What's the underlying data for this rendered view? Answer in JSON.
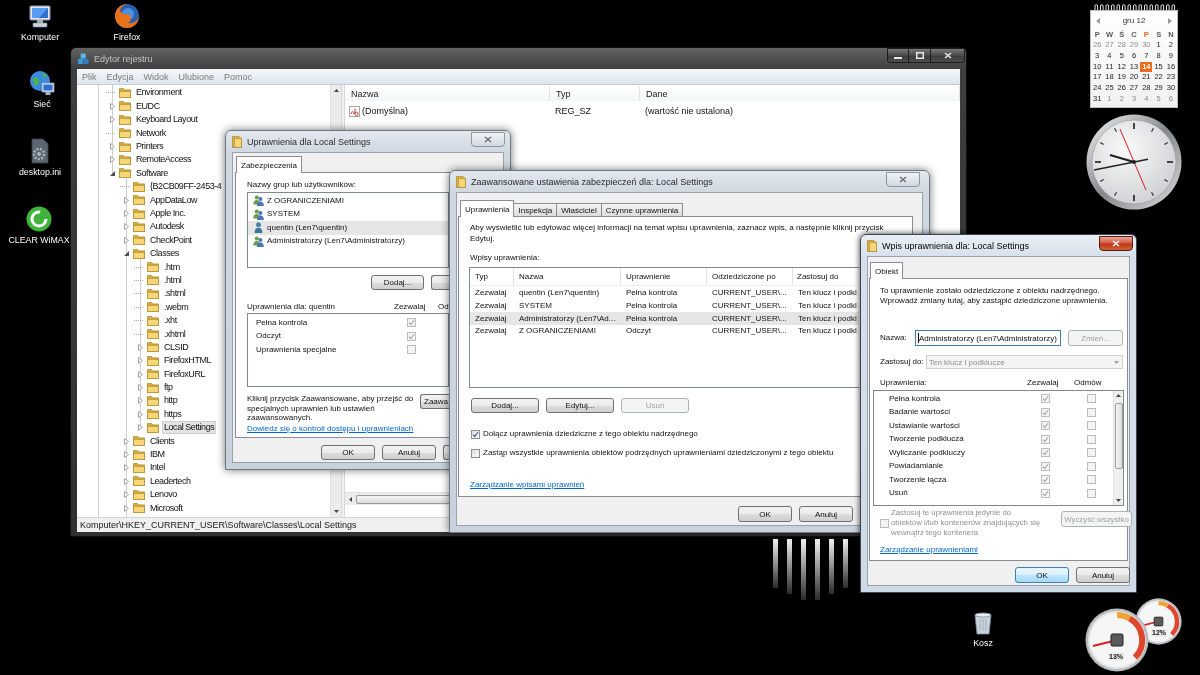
{
  "desktop_icons": [
    {
      "label": "Komputer",
      "kind": "computer"
    },
    {
      "label": "Firefox",
      "kind": "browser"
    },
    {
      "label": "Sieć",
      "kind": "network"
    },
    {
      "label": "desktop.ini",
      "kind": "settings_file"
    },
    {
      "label": "CLEAR WiMAX",
      "kind": "wimax"
    }
  ],
  "recycle_bin": {
    "label": "Kosz"
  },
  "calendar": {
    "month": "gru 12",
    "weekdays": [
      {
        "label": "P",
        "selected": false
      },
      {
        "label": "W",
        "selected": false
      },
      {
        "label": "Ś",
        "selected": false
      },
      {
        "label": "C",
        "selected": false
      },
      {
        "label": "P",
        "selected": true
      },
      {
        "label": "S",
        "selected": false
      },
      {
        "label": "N",
        "selected": false
      }
    ],
    "days": [
      {
        "day": "26",
        "outside": true,
        "selected": false
      },
      {
        "day": "27",
        "outside": true,
        "selected": false
      },
      {
        "day": "28",
        "outside": true,
        "selected": false
      },
      {
        "day": "29",
        "outside": true,
        "selected": false
      },
      {
        "day": "30",
        "outside": true,
        "selected": false
      },
      {
        "day": "1",
        "outside": false,
        "selected": false
      },
      {
        "day": "2",
        "outside": false,
        "selected": false
      },
      {
        "day": "3",
        "outside": false,
        "selected": false
      },
      {
        "day": "4",
        "outside": false,
        "selected": false
      },
      {
        "day": "5",
        "outside": false,
        "selected": false
      },
      {
        "day": "6",
        "outside": false,
        "selected": false
      },
      {
        "day": "7",
        "outside": false,
        "selected": false
      },
      {
        "day": "8",
        "outside": false,
        "selected": false
      },
      {
        "day": "9",
        "outside": false,
        "selected": false
      },
      {
        "day": "10",
        "outside": false,
        "selected": false
      },
      {
        "day": "11",
        "outside": false,
        "selected": false
      },
      {
        "day": "12",
        "outside": false,
        "selected": false
      },
      {
        "day": "13",
        "outside": false,
        "selected": false
      },
      {
        "day": "14",
        "outside": false,
        "selected": true
      },
      {
        "day": "15",
        "outside": false,
        "selected": false
      },
      {
        "day": "16",
        "outside": false,
        "selected": false
      },
      {
        "day": "17",
        "outside": false,
        "selected": false
      },
      {
        "day": "18",
        "outside": false,
        "selected": false
      },
      {
        "day": "19",
        "outside": false,
        "selected": false
      },
      {
        "day": "20",
        "outside": false,
        "selected": false
      },
      {
        "day": "21",
        "outside": false,
        "selected": false
      },
      {
        "day": "22",
        "outside": false,
        "selected": false
      },
      {
        "day": "23",
        "outside": false,
        "selected": false
      },
      {
        "day": "24",
        "outside": false,
        "selected": false
      },
      {
        "day": "25",
        "outside": false,
        "selected": false
      },
      {
        "day": "26",
        "outside": false,
        "selected": false
      },
      {
        "day": "27",
        "outside": false,
        "selected": false
      },
      {
        "day": "28",
        "outside": false,
        "selected": false
      },
      {
        "day": "29",
        "outside": false,
        "selected": false
      },
      {
        "day": "30",
        "outside": false,
        "selected": false
      },
      {
        "day": "31",
        "outside": false,
        "selected": false
      },
      {
        "day": "1",
        "outside": true,
        "selected": false
      },
      {
        "day": "2",
        "outside": true,
        "selected": false
      },
      {
        "day": "3",
        "outside": true,
        "selected": false
      },
      {
        "day": "4",
        "outside": true,
        "selected": false
      },
      {
        "day": "5",
        "outside": true,
        "selected": false
      },
      {
        "day": "6",
        "outside": true,
        "selected": false
      }
    ]
  },
  "cpu_meter": {
    "cpu_reading": "13%",
    "memory_reading": "12%"
  },
  "registry_editor": {
    "title": "Edytor rejestru",
    "active": false,
    "menu": [
      "Plik",
      "Edycja",
      "Widok",
      "Ulubione",
      "Pomoc"
    ],
    "tree": [
      {
        "label": "Environment",
        "kind": "leaf",
        "expanded": false,
        "selected": false
      },
      {
        "label": "EUDC",
        "kind": "branch",
        "expanded": false,
        "selected": false
      },
      {
        "label": "Keyboard Layout",
        "kind": "branch",
        "expanded": false,
        "selected": false
      },
      {
        "label": "Network",
        "kind": "leaf",
        "expanded": false,
        "selected": false
      },
      {
        "label": "Printers",
        "kind": "branch",
        "expanded": false,
        "selected": false
      },
      {
        "label": "RemoteAccess",
        "kind": "branch",
        "expanded": false,
        "selected": false
      },
      {
        "label": "Software",
        "kind": "branch",
        "expanded": true,
        "selected": false,
        "children": [
          {
            "label": "{B2CB09FF-2453-4",
            "kind": "leaf",
            "expanded": false,
            "selected": false
          },
          {
            "label": "AppDataLow",
            "kind": "branch",
            "expanded": false,
            "selected": false
          },
          {
            "label": "Apple Inc.",
            "kind": "branch",
            "expanded": false,
            "selected": false
          },
          {
            "label": "Autodesk",
            "kind": "branch",
            "expanded": false,
            "selected": false
          },
          {
            "label": "CheckPoint",
            "kind": "branch",
            "expanded": false,
            "selected": false
          },
          {
            "label": "Classes",
            "kind": "branch",
            "expanded": true,
            "selected": false,
            "children": [
              {
                "label": ".htm",
                "kind": "leaf",
                "expanded": false,
                "selected": false
              },
              {
                "label": ".html",
                "kind": "leaf",
                "expanded": false,
                "selected": false
              },
              {
                "label": ".shtml",
                "kind": "leaf",
                "expanded": false,
                "selected": false
              },
              {
                "label": ".webm",
                "kind": "leaf",
                "expanded": false,
                "selected": false
              },
              {
                "label": ".xht",
                "kind": "leaf",
                "expanded": false,
                "selected": false
              },
              {
                "label": ".xhtml",
                "kind": "leaf",
                "expanded": false,
                "selected": false
              },
              {
                "label": "CLSID",
                "kind": "branch",
                "expanded": false,
                "selected": false
              },
              {
                "label": "FirefoxHTML",
                "kind": "branch",
                "expanded": false,
                "selected": false
              },
              {
                "label": "FirefoxURL",
                "kind": "branch",
                "expanded": false,
                "selected": false
              },
              {
                "label": "ftp",
                "kind": "branch",
                "expanded": false,
                "selected": false
              },
              {
                "label": "http",
                "kind": "branch",
                "expanded": false,
                "selected": false
              },
              {
                "label": "https",
                "kind": "branch",
                "expanded": false,
                "selected": false
              },
              {
                "label": "Local Settings",
                "kind": "branch",
                "expanded": false,
                "selected": true
              }
            ]
          },
          {
            "label": "Clients",
            "kind": "branch",
            "expanded": false,
            "selected": false
          },
          {
            "label": "IBM",
            "kind": "branch",
            "expanded": false,
            "selected": false
          },
          {
            "label": "Intel",
            "kind": "branch",
            "expanded": false,
            "selected": false
          },
          {
            "label": "Leadertech",
            "kind": "branch",
            "expanded": false,
            "selected": false
          },
          {
            "label": "Lenovo",
            "kind": "branch",
            "expanded": false,
            "selected": false
          },
          {
            "label": "Microsoft",
            "kind": "branch",
            "expanded": false,
            "selected": false
          }
        ]
      }
    ],
    "values": {
      "columns": [
        "Nazwa",
        "Typ",
        "Dane"
      ],
      "rows": [
        {
          "cells": [
            "(Domyślna)",
            "REG_SZ",
            "(wartość nie ustalona)"
          ]
        }
      ]
    },
    "status_bar": "Komputer\\HKEY_CURRENT_USER\\Software\\Classes\\Local Settings"
  },
  "permissions_dialog": {
    "title": "Uprawnienia dla Local Settings",
    "active": false,
    "tabs": [
      {
        "label": "Zabezpieczenia",
        "selected": true
      }
    ],
    "users_label": "Nazwy grup lub użytkowników:",
    "users": [
      {
        "name": "Z OGRANICZENIAMI",
        "kind": "group",
        "selected": false
      },
      {
        "name": "SYSTEM",
        "kind": "group",
        "selected": false
      },
      {
        "name": "quentin (Len7\\quentin)",
        "kind": "user",
        "selected": true
      },
      {
        "name": "Administratorzy (Len7\\Administratorzy)",
        "kind": "group",
        "selected": false
      }
    ],
    "add_button": "Dodaj...",
    "permissions_label": "Uprawnienia dla: quentin",
    "columns": [
      "Zezwalaj",
      "Od"
    ],
    "permissions": [
      {
        "name": "Pełna kontrola",
        "allow": true
      },
      {
        "name": "Odczyt",
        "allow": true
      },
      {
        "name": "Uprawnienia specjalne",
        "allow": false
      }
    ],
    "advanced_hint": "Kliknij przycisk Zaawansowane, aby przejść do\nspecjalnych uprawnień lub ustawień\nzaawansowanych.",
    "advanced_button": "Zaawa",
    "link": "Dowiedz się o kontroli dostępu i uprawnieniach",
    "buttons": [
      "OK",
      "Anuluj"
    ]
  },
  "advanced_dialog": {
    "title": "Zaawansowane ustawienia zabezpieczeń dla: Local Settings",
    "active": false,
    "tabs": [
      {
        "label": "Uprawnienia",
        "selected": true
      },
      {
        "label": "Inspekcja",
        "selected": false
      },
      {
        "label": "Właściciel",
        "selected": false
      },
      {
        "label": "Czynne uprawnienia",
        "selected": false
      }
    ],
    "intro": "Aby wyświetlić lub edytować więcej informacji na temat wpisu uprawnienia, zaznacz wpis, a następnie kliknij przycisk\nEdytuj.",
    "entries_label": "Wpisy uprawnienia:",
    "table": {
      "columns": [
        "Typ",
        "Nazwa",
        "Uprawnienie",
        "Odziedziczone po",
        "Zastosuj do"
      ],
      "rows": [
        {
          "cells": [
            "Zezwalaj",
            "quentin (Len7\\quentin)",
            "Pełna kontrola",
            "CURRENT_USER\\...",
            "Ten klucz i podkl"
          ],
          "selected": false
        },
        {
          "cells": [
            "Zezwalaj",
            "SYSTEM",
            "Pełna kontrola",
            "CURRENT_USER\\...",
            "Ten klucz i podkl"
          ],
          "selected": false
        },
        {
          "cells": [
            "Zezwalaj",
            "Administratorzy (Len7\\Ad...",
            "Pełna kontrola",
            "CURRENT_USER\\...",
            "Ten klucz i podkl"
          ],
          "selected": true
        },
        {
          "cells": [
            "Zezwalaj",
            "Z OGRANICZENIAMI",
            "Odczyt",
            "CURRENT_USER\\...",
            "Ten klucz i podkl"
          ],
          "selected": false
        }
      ]
    },
    "buttons": [
      {
        "label": "Dodaj...",
        "disabled": false
      },
      {
        "label": "Edytuj...",
        "disabled": false
      },
      {
        "label": "Usuń",
        "disabled": true
      }
    ],
    "options": [
      {
        "label": "Dołącz uprawnienia dziedziczne z tego obiektu nadrzędnego",
        "checked": true
      },
      {
        "label": "Zastąp wszystkie uprawnienia obiektów podrzędnych uprawnieniami dziedziczonymi z tego obiektu",
        "checked": false
      }
    ],
    "link": "Zarządzanie wpisami uprawnień",
    "footer_buttons": [
      "OK",
      "Anuluj"
    ]
  },
  "entry_dialog": {
    "title": "Wpis uprawnienia dla: Local Settings",
    "active": true,
    "tabs": [
      {
        "label": "Obiekt",
        "selected": true
      }
    ],
    "info": "To uprawnienie zostało odziedziczone z obiektu nadrzędnego.\nWprowadź zmiany tutaj, aby zastąpić dziedziczone uprawnienia.",
    "name_label": "Nazwa:",
    "name_field": {
      "value": "Administratorzy (Len7\\Administratorzy)",
      "focused": true
    },
    "change_button": {
      "label": "Zmień...",
      "disabled": true
    },
    "apply_label": "Zastosuj do:",
    "apply_to": {
      "value": "Ten klucz i podklucze",
      "disabled": true
    },
    "permissions_label": "Uprawnienia:",
    "columns": [
      "Zezwalaj",
      "Odmów"
    ],
    "permissions": [
      {
        "name": "Pełna kontrola",
        "allow": true,
        "deny": false
      },
      {
        "name": "Badanie wartości",
        "allow": true,
        "deny": false
      },
      {
        "name": "Ustawianie wartości",
        "allow": true,
        "deny": false
      },
      {
        "name": "Tworzenie podklucza",
        "allow": true,
        "deny": false
      },
      {
        "name": "Wyliczanie podkluczy",
        "allow": true,
        "deny": false
      },
      {
        "name": "Powiadamianie",
        "allow": true,
        "deny": false
      },
      {
        "name": "Tworzenie łącza",
        "allow": true,
        "deny": false
      },
      {
        "name": "Usuń",
        "allow": true,
        "deny": false
      }
    ],
    "apply_inside": {
      "label": "Zastosuj te uprawnienia jedynie do\nobiektów i/lub kontenerów znajdujących się\nwewnątrz tego kontenera",
      "checked": false,
      "disabled": true
    },
    "clear_button": {
      "label": "Wyczyść wszystko",
      "disabled": true
    },
    "link": "Zarządzanie uprawnieniami",
    "buttons": [
      {
        "label": "OK",
        "default": true
      },
      {
        "label": "Anuluj",
        "default": false
      }
    ]
  }
}
